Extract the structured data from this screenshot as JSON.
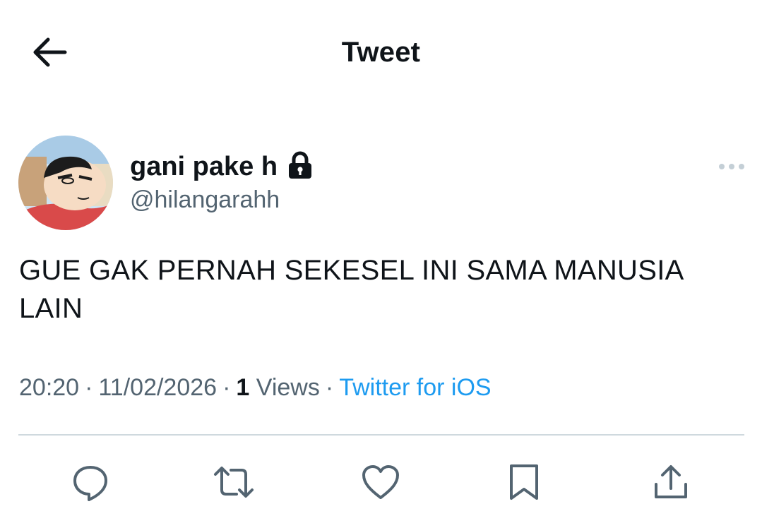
{
  "header": {
    "title": "Tweet",
    "back_icon": "arrow-left-icon"
  },
  "author": {
    "display_name": "gani pake h",
    "handle": "@hilangarahh",
    "protected_icon": "lock-icon"
  },
  "tweet": {
    "text": "GUE GAK PERNAH SEKESEL INI SAMA MANUSIA LAIN",
    "time": "20:20",
    "date": "11/02/2026",
    "views_count": "1",
    "views_label": "Views",
    "source": "Twitter for iOS",
    "separator": "·"
  },
  "actions": [
    "reply-icon",
    "retweet-icon",
    "like-icon",
    "bookmark-icon",
    "share-icon"
  ],
  "colors": {
    "text": "#0f1419",
    "secondary": "#536471",
    "link": "#1d9bf0",
    "divider": "#cfd9de"
  }
}
